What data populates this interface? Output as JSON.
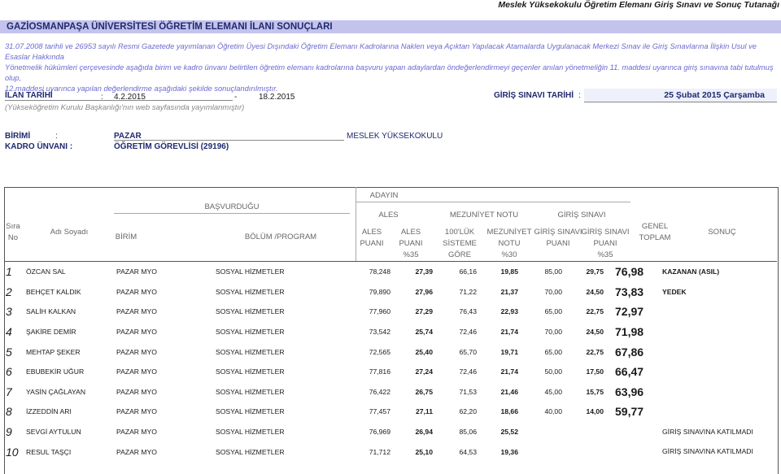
{
  "header": {
    "top_right": "Meslek Yüksekokulu Öğretim Elemanı Giriş Sınavı ve Sonuç Tutanağı",
    "title": "GAZİOSMANPAŞA ÜNİVERSİTESİ ÖĞRETİM ELEMANI İLANI SONUÇLARI",
    "intro_line1": "31.07.2008 tarihli ve 26953 sayılı Resmi Gazetede yayımlanan Öğretim Üyesi Dışındaki Öğretim Elemanı Kadrolarına Naklen veya Açıktan Yapılacak Atamalarda Uygulanacak Merkezi Sınav ile Giriş Sınavlarına İlişkin Usul ve Esaslar Hakkında",
    "intro_line2": "Yönetmelik hükümleri çerçevesinde aşağıda birim ve kadro ünvanı belirtilen öğretim elemanı kadrolarına başvuru yapan adaylardan öndeğerlendirmeyi geçenler anılan yönetmeliğin 11. maddesi uyarınca giriş sınavına tabi tutulmuş olup,",
    "intro_line3": "12.maddesi uyarınca yapılan değerlendirme aşağıdaki şekilde sonuçlandırılmıştır."
  },
  "ilan": {
    "label": "İLAN TARİHİ",
    "colon": ":",
    "start": "4.2.2015",
    "dash": "-",
    "end": "18.2.2015",
    "sinav_label": "GİRİŞ SINAVI TARİHİ",
    "sinav_colon": ":",
    "sinav_date": "25 Şubat 2015 Çarşamba",
    "note": "(Yükseköğretim Kurulu Başkanlığı'nın web sayfasında yayımlanmıştır)"
  },
  "unit": {
    "birim_label": "BİRİMİ",
    "birim_colon": ":",
    "birim_value": "PAZAR",
    "birim_school": "MESLEK YÜKSEKOKULU",
    "kadro_label": "KADRO ÜNVANI :",
    "kadro_value": "ÖĞRETİM GÖREVLİSİ (29196)"
  },
  "table_headers": {
    "adayin": "ADAYIN",
    "basvurdugu": "BAŞVURDUĞU",
    "ales_group": "ALES",
    "mezuniyet_group": "MEZUNİYET NOTU",
    "giris_group": "GİRİŞ SINAVI",
    "sira": "Sıra",
    "no": "No",
    "ad_soyad": "Adı Soyadı",
    "birim": "BİRİM",
    "bolum": "BÖLÜM /PROGRAM",
    "ales_puani": "ALES",
    "ales_puani2": "PUANI",
    "ales_35a": "ALES",
    "ales_35b": "PUANI",
    "ales_35c": "%35",
    "mez_100a": "100'LÜK",
    "mez_100b": "SİSTEME",
    "mez_100c": "GÖRE",
    "mez_30a": "MEZUNİYET",
    "mez_30b": "NOTU",
    "mez_30c": "%30",
    "gs_puani_a": "GİRİŞ SINAVI",
    "gs_puani_b": "PUANI",
    "gs_35a": "GİRİŞ SINAVI",
    "gs_35b": "PUANI",
    "gs_35c": "%35",
    "genel_a": "GENEL",
    "genel_b": "TOPLAM",
    "sonuc": "SONUÇ"
  },
  "rows": [
    {
      "no": "1",
      "name": "ÖZCAN SAL",
      "birim": "PAZAR MYO",
      "bolum": "SOSYAL HİZMETLER",
      "ales": "78,248",
      "ales35": "27,39",
      "mez100": "66,16",
      "mez30": "19,85",
      "gs": "85,00",
      "gs35": "29,75",
      "toplam": "76,98",
      "sonuc": "KAZANAN (ASIL)"
    },
    {
      "no": "2",
      "name": "BEHÇET KALDIK",
      "birim": "PAZAR MYO",
      "bolum": "SOSYAL HİZMETLER",
      "ales": "79,890",
      "ales35": "27,96",
      "mez100": "71,22",
      "mez30": "21,37",
      "gs": "70,00",
      "gs35": "24,50",
      "toplam": "73,83",
      "sonuc": "YEDEK"
    },
    {
      "no": "3",
      "name": "SALİH KALKAN",
      "birim": "PAZAR MYO",
      "bolum": "SOSYAL HİZMETLER",
      "ales": "77,960",
      "ales35": "27,29",
      "mez100": "76,43",
      "mez30": "22,93",
      "gs": "65,00",
      "gs35": "22,75",
      "toplam": "72,97",
      "sonuc": ""
    },
    {
      "no": "4",
      "name": "ŞAKİRE DEMİR",
      "birim": "PAZAR MYO",
      "bolum": "SOSYAL HİZMETLER",
      "ales": "73,542",
      "ales35": "25,74",
      "mez100": "72,46",
      "mez30": "21,74",
      "gs": "70,00",
      "gs35": "24,50",
      "toplam": "71,98",
      "sonuc": ""
    },
    {
      "no": "5",
      "name": "MEHTAP ŞEKER",
      "birim": "PAZAR MYO",
      "bolum": "SOSYAL HİZMETLER",
      "ales": "72,565",
      "ales35": "25,40",
      "mez100": "65,70",
      "mez30": "19,71",
      "gs": "65,00",
      "gs35": "22,75",
      "toplam": "67,86",
      "sonuc": ""
    },
    {
      "no": "6",
      "name": "EBUBEKİR UĞUR",
      "birim": "PAZAR MYO",
      "bolum": "SOSYAL HİZMETLER",
      "ales": "77,816",
      "ales35": "27,24",
      "mez100": "72,46",
      "mez30": "21,74",
      "gs": "50,00",
      "gs35": "17,50",
      "toplam": "66,47",
      "sonuc": ""
    },
    {
      "no": "7",
      "name": "YASİN ÇAĞLAYAN",
      "birim": "PAZAR MYO",
      "bolum": "SOSYAL HİZMETLER",
      "ales": "76,422",
      "ales35": "26,75",
      "mez100": "71,53",
      "mez30": "21,46",
      "gs": "45,00",
      "gs35": "15,75",
      "toplam": "63,96",
      "sonuc": ""
    },
    {
      "no": "8",
      "name": "İZZEDDİN ARI",
      "birim": "PAZAR MYO",
      "bolum": "SOSYAL HİZMETLER",
      "ales": "77,457",
      "ales35": "27,11",
      "mez100": "62,20",
      "mez30": "18,66",
      "gs": "40,00",
      "gs35": "14,00",
      "toplam": "59,77",
      "sonuc": ""
    },
    {
      "no": "9",
      "name": "SEVGİ AYTULUN",
      "birim": "PAZAR MYO",
      "bolum": "SOSYAL HİZMETLER",
      "ales": "76,969",
      "ales35": "26,94",
      "mez100": "85,06",
      "mez30": "25,52",
      "gs": "",
      "gs35": "",
      "toplam": "",
      "sonuc": "GİRİŞ SINAVINA KATILMADI"
    },
    {
      "no": "10",
      "name": "RESUL TAŞÇI",
      "birim": "PAZAR MYO",
      "bolum": "SOSYAL HİZMETLER",
      "ales": "71,712",
      "ales35": "25,10",
      "mez100": "64,53",
      "mez30": "19,36",
      "gs": "",
      "gs35": "",
      "toplam": "",
      "sonuc": "GİRİŞ SINAVINA KATILMADI"
    }
  ]
}
